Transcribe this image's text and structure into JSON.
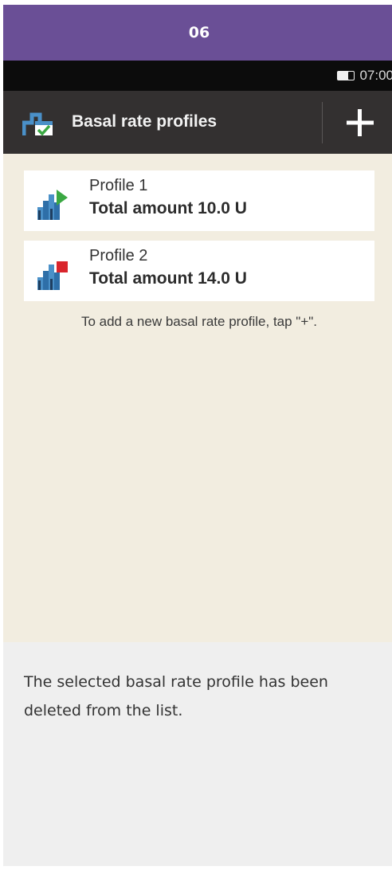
{
  "step": {
    "number": "06"
  },
  "status_bar": {
    "time": "07:00",
    "battery_icon": "battery-icon"
  },
  "title_bar": {
    "title": "Basal rate profiles",
    "icon": "basal-profile-icon",
    "add_button": "plus-icon"
  },
  "profiles": [
    {
      "name": "Profile 1",
      "total": "Total amount 10.0 U",
      "icon": "profile-active-icon",
      "marker_color": "#3aa842"
    },
    {
      "name": "Profile 2",
      "total": "Total amount 14.0 U",
      "icon": "profile-inactive-icon",
      "marker_color": "#d9252c"
    }
  ],
  "hint": "To add a new basal rate profile, tap \"+\".",
  "caption": "The selected basal rate profile has been deleted from the list.",
  "colors": {
    "header": "#6a4f96",
    "title_bar": "#333030",
    "device_background": "#f2ede0",
    "caption_background": "#efefef"
  }
}
